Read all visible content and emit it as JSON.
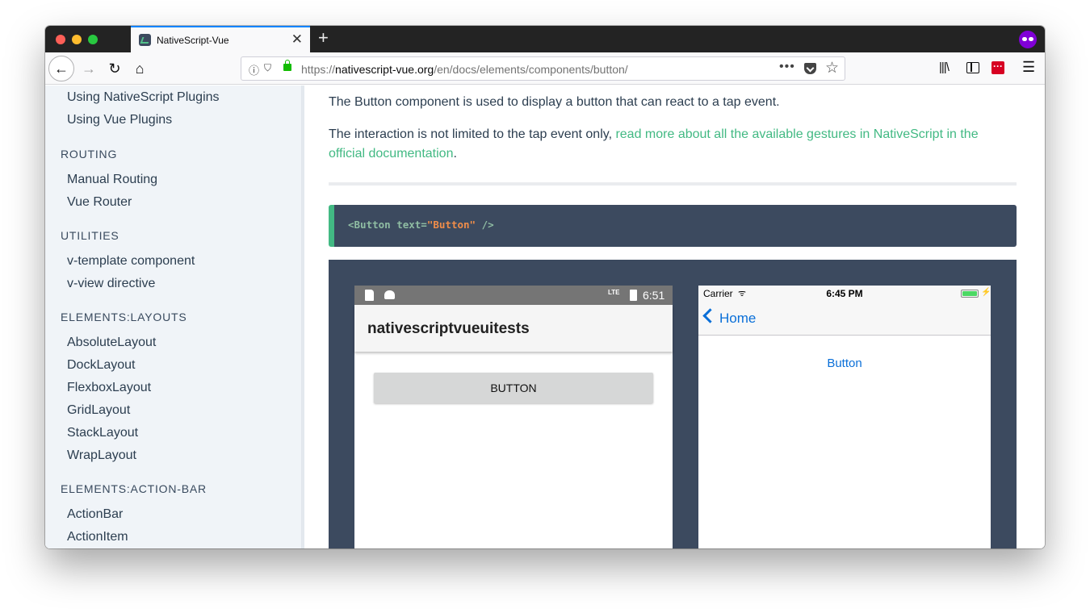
{
  "browser": {
    "tab_title": "NativeScript-Vue",
    "tab_close": "✕",
    "new_tab": "+",
    "url_prefix": "https://",
    "url_host": "nativescript-vue.org",
    "url_path": "/en/docs/elements/components/button/",
    "buttons": {
      "back": "←",
      "forward": "→",
      "reload": "↻",
      "home": "⌂",
      "more": "•••",
      "star": "☆",
      "menu": "☰",
      "library": "|||\\"
    }
  },
  "sidebar": {
    "items_top": [
      "Using NativeScript Plugins",
      "Using Vue Plugins"
    ],
    "sections": [
      {
        "heading": "ROUTING",
        "items": [
          "Manual Routing",
          "Vue Router"
        ]
      },
      {
        "heading": "UTILITIES",
        "items": [
          "v-template component",
          "v-view directive"
        ]
      },
      {
        "heading": "ELEMENTS:LAYOUTS",
        "items": [
          "AbsoluteLayout",
          "DockLayout",
          "FlexboxLayout",
          "GridLayout",
          "StackLayout",
          "WrapLayout"
        ]
      },
      {
        "heading": "ELEMENTS:ACTION-BAR",
        "items": [
          "ActionBar",
          "ActionItem"
        ]
      }
    ]
  },
  "content": {
    "intro": "The Button component is used to display a button that can react to a tap event.",
    "interaction_prefix": "The interaction is not limited to the tap event only, ",
    "interaction_link": "read more about all the available gestures in NativeScript in the official documentation",
    "interaction_suffix": ".",
    "code": {
      "tag_open": "<Button text=",
      "attr_value": "\"Button\"",
      "tag_close": " />"
    }
  },
  "android_demo": {
    "status_lte": "LTE",
    "status_time": "6:51",
    "app_title": "nativescriptvueuitests",
    "button_label": "BUTTON"
  },
  "ios_demo": {
    "carrier": "Carrier",
    "wifi": "ᯤ",
    "time": "6:45 PM",
    "bolt": "⚡",
    "back_label": "Home",
    "button_label": "Button"
  },
  "colors": {
    "accent": "#42b983",
    "code_bg": "#3c4a5f",
    "sidebar_bg": "#f0f4f8",
    "ios_blue": "#0a6fd8"
  }
}
